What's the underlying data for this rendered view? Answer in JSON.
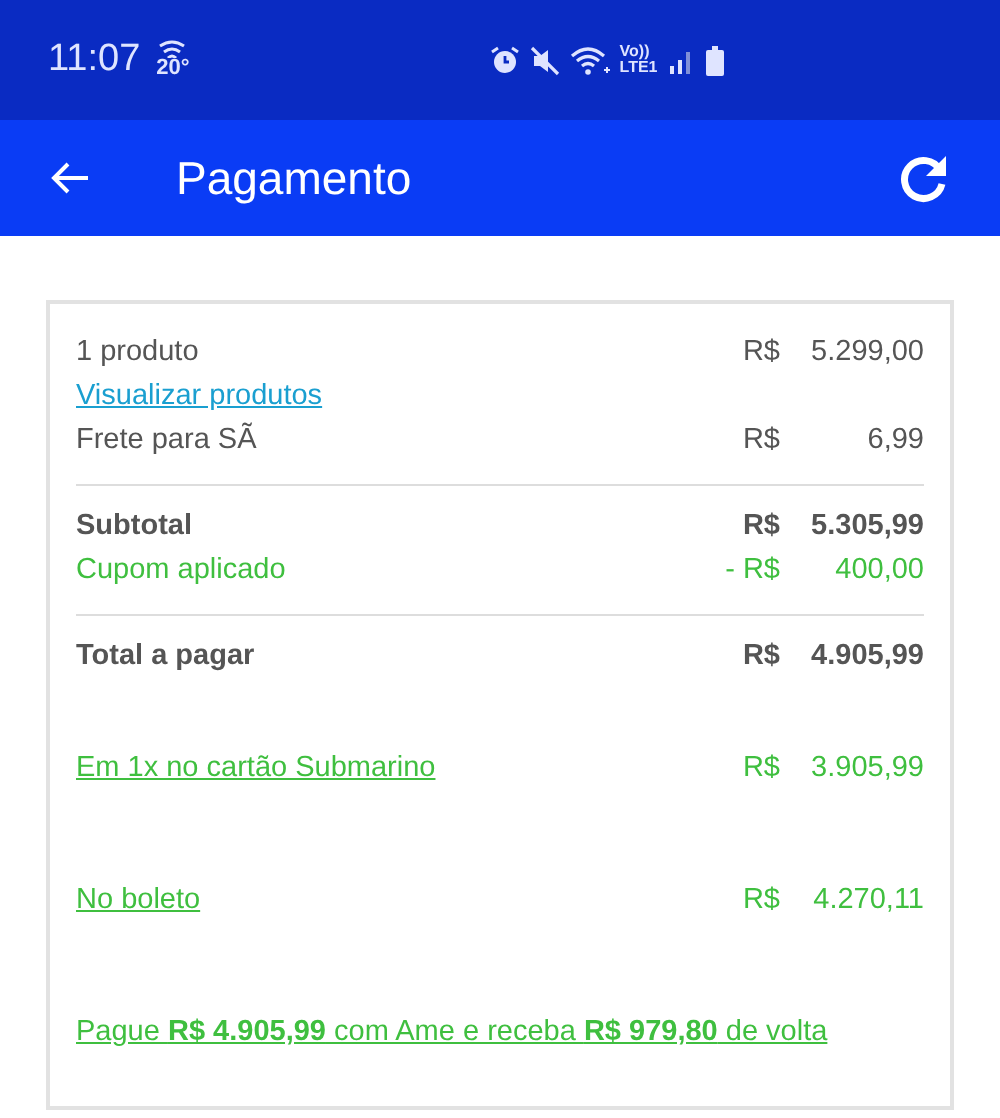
{
  "status_bar": {
    "time": "11:07",
    "temperature": "20°",
    "volte": "Vo))",
    "network": "LTE1"
  },
  "app_bar": {
    "title": "Pagamento"
  },
  "summary_groups": [
    [
      {
        "kind": "plain",
        "label": "1 produto",
        "currency": "R$",
        "amount": "5.299,00"
      },
      {
        "kind": "link",
        "label": "Visualizar produtos"
      },
      {
        "kind": "plain",
        "label": "Frete para SÃ",
        "currency": "R$",
        "amount": "6,99"
      }
    ],
    [
      {
        "kind": "bold",
        "label": "Subtotal",
        "currency": "R$",
        "amount": "5.305,99"
      },
      {
        "kind": "discount",
        "label": "Cupom aplicado",
        "currency": "- R$",
        "amount": "400,00"
      }
    ],
    [
      {
        "kind": "bold",
        "label": "Total a pagar",
        "currency": "R$",
        "amount": "4.905,99"
      }
    ]
  ],
  "payment_options": [
    {
      "label": "Em 1x no cartão Submarino",
      "currency": "R$",
      "amount": "3.905,99"
    },
    {
      "label": "No boleto",
      "currency": "R$",
      "amount": "4.270,11"
    },
    {
      "label": "Pague **R$ 4.905,99** com Ame e receba **R$ 979,80** de volta"
    }
  ]
}
